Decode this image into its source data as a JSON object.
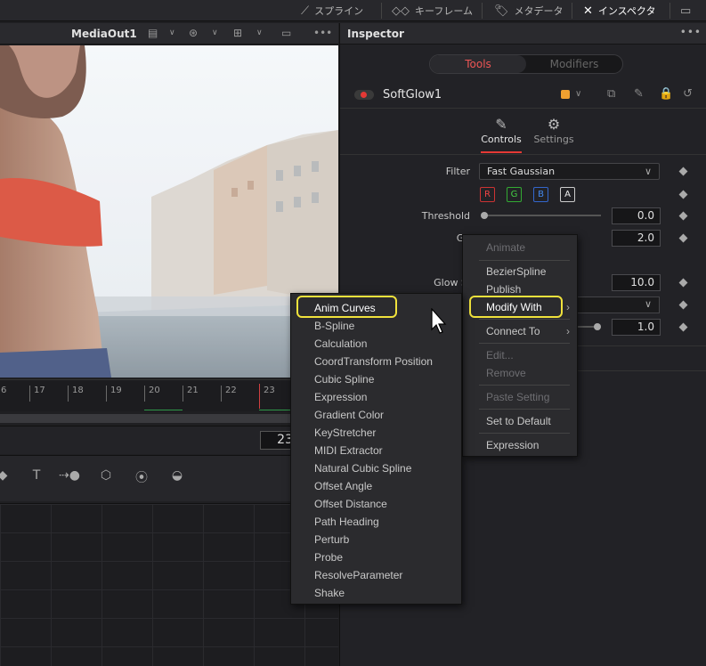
{
  "topbar": {
    "items": [
      {
        "label": "スプライン",
        "icon": "spline-icon"
      },
      {
        "label": "キーフレーム",
        "icon": "keyframes-icon"
      },
      {
        "label": "メタデータ",
        "icon": "metadata-icon"
      },
      {
        "label": "インスペクタ",
        "icon": "inspector-tools-icon"
      }
    ]
  },
  "viewer": {
    "title": "MediaOut1",
    "more": "•••"
  },
  "timeline": {
    "ticks": [
      "6",
      "17",
      "18",
      "19",
      "20",
      "21",
      "22",
      "23"
    ],
    "current_frame": "23"
  },
  "inspector": {
    "title": "Inspector",
    "more": "•••",
    "seg_tools": "Tools",
    "seg_modifiers": "Modifiers",
    "node_name": "SoftGlow1",
    "tab_controls": "Controls",
    "tab_settings": "Settings",
    "filter_label": "Filter",
    "filter_value": "Fast Gaussian",
    "channels": [
      "R",
      "G",
      "B",
      "A"
    ],
    "threshold_label": "Threshold",
    "threshold_value": "0.0",
    "gain_label": "Ga",
    "gain_value": "2.0",
    "glowsize_label": "Glow Si",
    "glowsize_value": "10.0",
    "blend_value": "1.0"
  },
  "context_menu": {
    "items": [
      {
        "label": "Animate",
        "disabled": false
      },
      {
        "label": "BezierSpline",
        "disabled": false
      },
      {
        "label": "Publish",
        "disabled": false
      },
      {
        "label": "Modify With",
        "disabled": false
      },
      {
        "label": "Connect To",
        "disabled": false
      },
      {
        "label": "Edit...",
        "disabled": true
      },
      {
        "label": "Remove",
        "disabled": true
      },
      {
        "label": "Paste Setting",
        "disabled": true
      },
      {
        "label": "Set to Default",
        "disabled": false
      },
      {
        "label": "Expression",
        "disabled": false
      }
    ]
  },
  "submenu": {
    "items": [
      "Anim Curves",
      "B-Spline",
      "Calculation",
      "CoordTransform Position",
      "Cubic Spline",
      "Expression",
      "Gradient Color",
      "KeyStretcher",
      "MIDI Extractor",
      "Natural Cubic Spline",
      "Offset Angle",
      "Offset Distance",
      "Path Heading",
      "Perturb",
      "Probe",
      "ResolveParameter",
      "Shake"
    ]
  },
  "colors": {
    "accent_red": "#e53935",
    "highlight_yellow": "#f0e23c",
    "node_color": "#f0a030"
  }
}
